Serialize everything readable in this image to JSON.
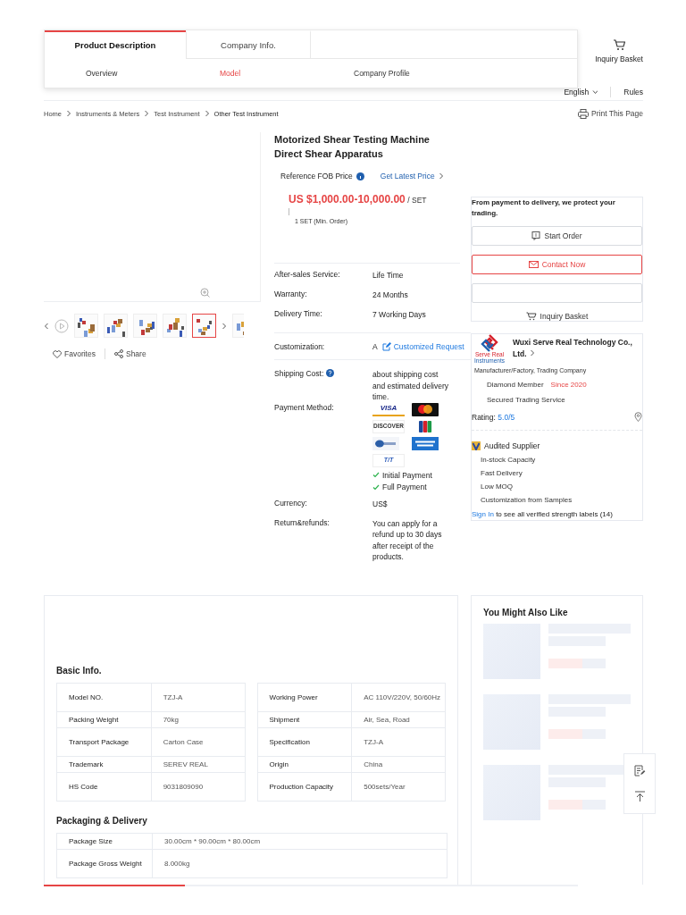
{
  "product_tabs": [
    {
      "label": "Product Description",
      "selected": true
    },
    {
      "label": "Company Info.",
      "selected": false
    }
  ],
  "sub_tabs": [
    {
      "label": "Overview",
      "selected": false
    },
    {
      "label": "Model",
      "selected": true
    },
    {
      "label": "Company Profile",
      "selected": false
    }
  ],
  "header": {
    "inquiry_basket": "Inquiry Basket",
    "nav": [
      "English",
      "Rules"
    ]
  },
  "breadcrumb": [
    "Home",
    "Instruments & Meters",
    "Test Instrument",
    "Other Test Instrument"
  ],
  "print_link": "Print This Page",
  "gallery": {
    "thumbnails": [
      {
        "selected": false
      },
      {
        "selected": false
      },
      {
        "selected": false
      },
      {
        "selected": false
      },
      {
        "selected": true
      },
      {
        "selected": false
      }
    ],
    "actions": [
      "Favorites",
      "Share"
    ]
  },
  "product": {
    "title": "Motorized Shear Testing Machine Direct Shear Apparatus",
    "price_label": "Reference FOB Price",
    "latest_price_link": "Get Latest Price",
    "price": "US $1,000.00-10,000.00",
    "unit": "/ SET",
    "min_order": "1 SET (Min. Order)"
  },
  "specs": [
    {
      "label": "After-sales Service:",
      "value": "Life Time"
    },
    {
      "label": "Warranty:",
      "value": "24 Months"
    },
    {
      "label": "Delivery Time:",
      "value": "7 Working Days"
    }
  ],
  "customization": {
    "label": "Customization:",
    "value": "A",
    "link": "Customized Request"
  },
  "shipping": {
    "label": "Shipping Cost:",
    "value": "about shipping cost and estimated delivery time."
  },
  "payment": {
    "label": "Payment Method:",
    "cards": [
      {
        "kind": "visa",
        "label": "VISA"
      },
      {
        "kind": "mastercard"
      },
      {
        "kind": "discover",
        "label": "DISCOVER"
      },
      {
        "kind": "jcb"
      },
      {
        "kind": "diners"
      },
      {
        "kind": "amex"
      },
      {
        "kind": "tt",
        "label": "T/T"
      }
    ],
    "terms": [
      "Initial Payment",
      "Full Payment"
    ]
  },
  "currency": {
    "label": "Currency:",
    "value": "US$"
  },
  "returns": {
    "label": "Return&refunds:",
    "value": "You can apply for a refund up to 30 days after receipt of the products."
  },
  "trade_card": {
    "note": "From payment to delivery, we protect your trading.",
    "buttons": [
      {
        "kind": "start",
        "label": "Start Order"
      },
      {
        "kind": "contact",
        "label": "Contact Now"
      },
      {
        "kind": "blank"
      }
    ],
    "basket_link": "Inquiry Basket"
  },
  "supplier": {
    "name": "Wuxi Serve Real Technology Co., Ltd.",
    "logo_text": [
      "Serve Real",
      "Instruments"
    ],
    "type": "Manufacturer/Factory, Trading Company",
    "member": "Diamond Member",
    "since": "Since 2020",
    "secured": "Secured Trading Service",
    "rating_label": "Rating:",
    "rating": "5.0/5",
    "audited": "Audited Supplier",
    "strengths": [
      "In-stock Capacity",
      "Fast Delivery",
      "Low MOQ",
      "Customization from Samples"
    ],
    "sign_in": "Sign In",
    "sign_in_note": "to see all verified strength labels (14)"
  },
  "details": {
    "basic_title": "Basic Info.",
    "basic_left": [
      {
        "label": "Model NO.",
        "value": "TZJ-A"
      },
      {
        "label": "Packing Weight",
        "value": "70kg"
      },
      {
        "label": "Transport Package",
        "value": "Carton Case"
      },
      {
        "label": "Trademark",
        "value": "SEREV REAL"
      },
      {
        "label": "HS Code",
        "value": "9031809090"
      }
    ],
    "basic_right": [
      {
        "label": "Working Power",
        "value": "AC 110V/220V, 50/60Hz"
      },
      {
        "label": "Shipment",
        "value": "Air, Sea, Road"
      },
      {
        "label": "Specification",
        "value": "TZJ-A"
      },
      {
        "label": "Origin",
        "value": "China"
      },
      {
        "label": "Production Capacity",
        "value": "500sets/Year"
      }
    ],
    "packaging_title": "Packaging & Delivery",
    "packaging": [
      {
        "label": "Package Size",
        "value": "30.00cm * 90.00cm * 80.00cm"
      },
      {
        "label": "Package Gross Weight",
        "value": "8.000kg"
      }
    ]
  },
  "also_like": {
    "title": "You Might Also Like"
  }
}
